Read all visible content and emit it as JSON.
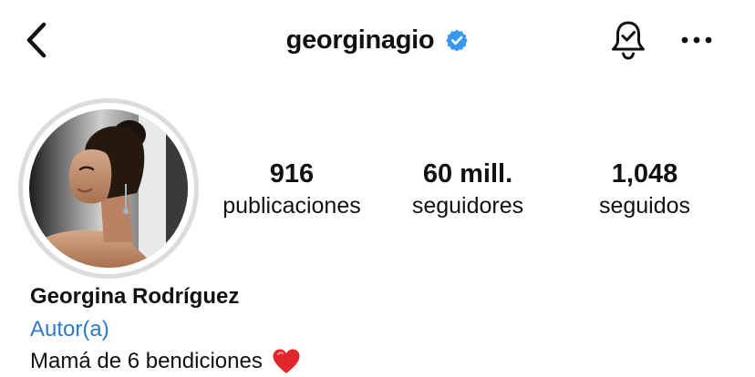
{
  "header": {
    "username": "georginagio",
    "verified": true,
    "icons": {
      "back": "chevron-left-icon",
      "verified": "verified-badge-icon",
      "notifications": "bell-check-icon",
      "more": "more-horizontal-icon"
    }
  },
  "profile": {
    "avatar_alt": "Georgina Rodríguez",
    "stats": [
      {
        "value": "916",
        "label": "publicaciones"
      },
      {
        "value": "60 mill.",
        "label": "seguidores"
      },
      {
        "value": "1,048",
        "label": "seguidos"
      }
    ],
    "name": "Georgina Rodríguez",
    "category": "Autor(a)",
    "bio": "Mamá de 6 bendiciones",
    "bio_emoji": "red-heart-icon"
  },
  "colors": {
    "verified_blue": "#3897f0",
    "link_blue": "#2e7ac9",
    "heart_red": "#e0262b",
    "ring_gray": "#dcdcdc"
  }
}
